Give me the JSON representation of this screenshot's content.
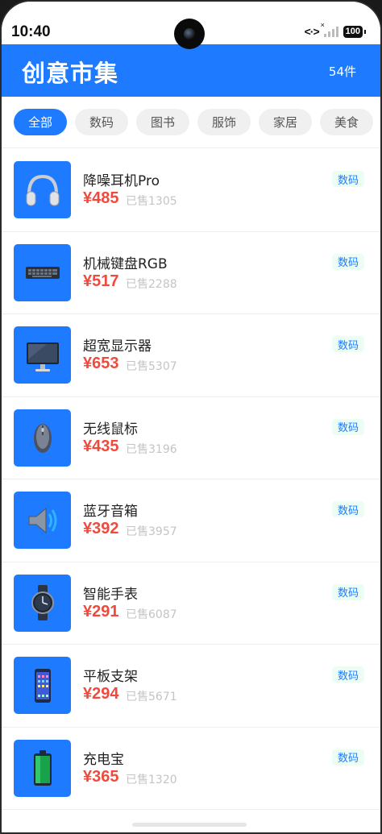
{
  "status_bar": {
    "time": "10:40",
    "battery": "100"
  },
  "header": {
    "title": "创意市集",
    "count": "54件"
  },
  "tabs": [
    {
      "label": "全部",
      "active": true
    },
    {
      "label": "数码",
      "active": false
    },
    {
      "label": "图书",
      "active": false
    },
    {
      "label": "服饰",
      "active": false
    },
    {
      "label": "家居",
      "active": false
    },
    {
      "label": "美食",
      "active": false
    }
  ],
  "products": [
    {
      "name": "降噪耳机Pro",
      "price": "¥485",
      "sold": "已售1305",
      "tag": "数码",
      "icon": "headphones-icon"
    },
    {
      "name": "机械键盘RGB",
      "price": "¥517",
      "sold": "已售2288",
      "tag": "数码",
      "icon": "keyboard-icon"
    },
    {
      "name": "超宽显示器",
      "price": "¥653",
      "sold": "已售5307",
      "tag": "数码",
      "icon": "monitor-icon"
    },
    {
      "name": "无线鼠标",
      "price": "¥435",
      "sold": "已售3196",
      "tag": "数码",
      "icon": "mouse-icon"
    },
    {
      "name": "蓝牙音箱",
      "price": "¥392",
      "sold": "已售3957",
      "tag": "数码",
      "icon": "speaker-icon"
    },
    {
      "name": "智能手表",
      "price": "¥291",
      "sold": "已售6087",
      "tag": "数码",
      "icon": "watch-icon"
    },
    {
      "name": "平板支架",
      "price": "¥294",
      "sold": "已售5671",
      "tag": "数码",
      "icon": "tablet-icon"
    },
    {
      "name": "充电宝",
      "price": "¥365",
      "sold": "已售1320",
      "tag": "数码",
      "icon": "battery-pack-icon"
    }
  ],
  "colors": {
    "accent": "#1e7bff",
    "price": "#f04a3c",
    "tag_bg": "#ecfdf4"
  }
}
